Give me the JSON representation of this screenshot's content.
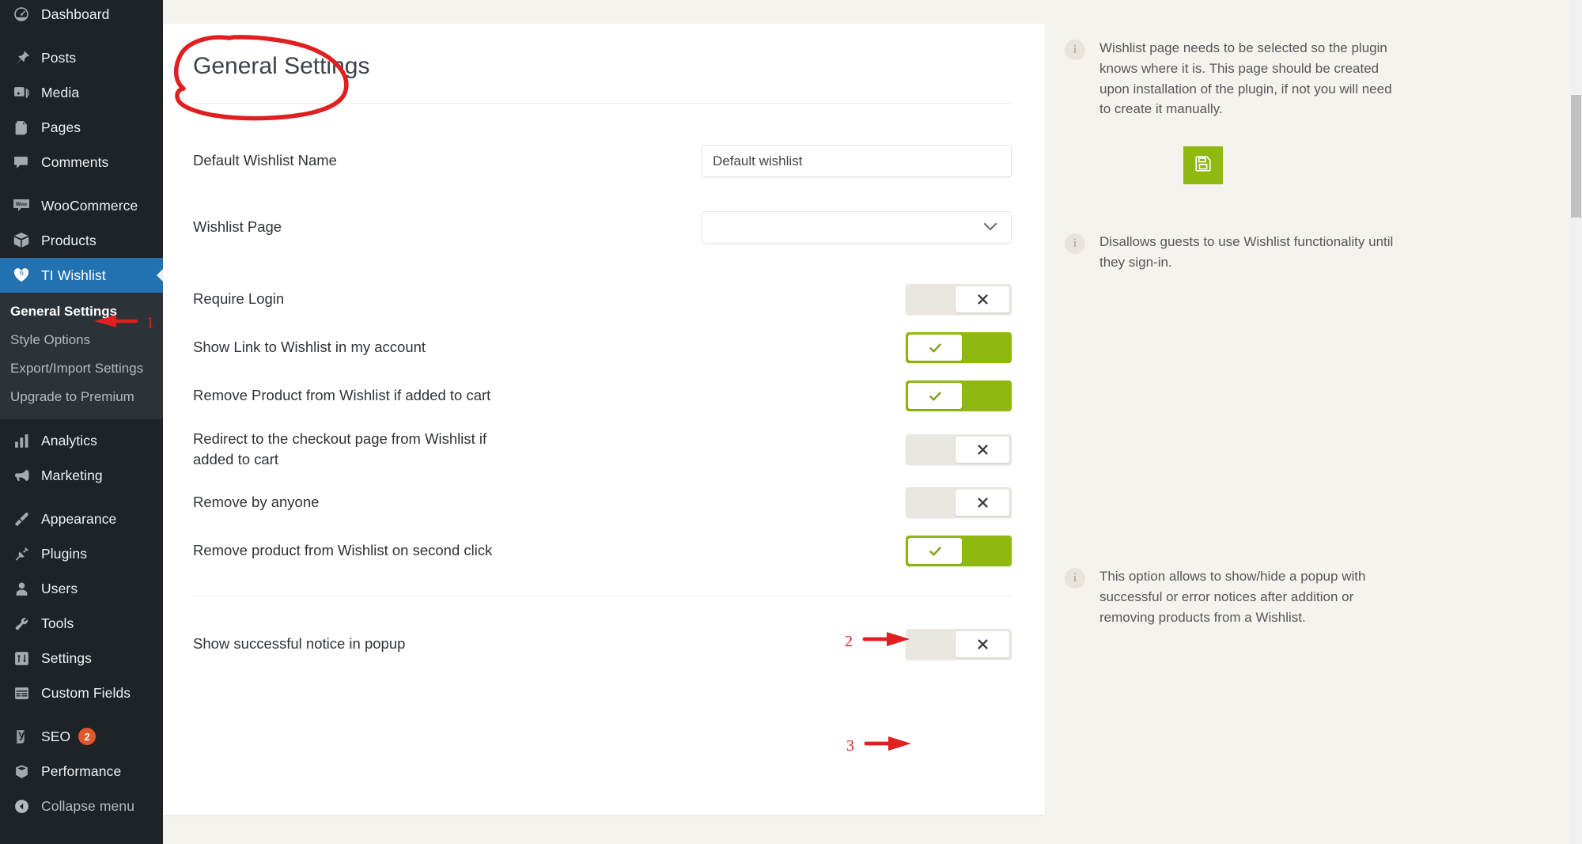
{
  "sidebar": {
    "items": [
      {
        "label": "Dashboard",
        "icon": "dashboard-icon"
      },
      {
        "label": "Posts",
        "icon": "pin-icon"
      },
      {
        "label": "Media",
        "icon": "media-icon"
      },
      {
        "label": "Pages",
        "icon": "pages-icon"
      },
      {
        "label": "Comments",
        "icon": "comment-icon"
      },
      {
        "label": "WooCommerce",
        "icon": "woo-icon"
      },
      {
        "label": "Products",
        "icon": "products-icon"
      },
      {
        "label": "TI Wishlist",
        "icon": "heart-icon"
      },
      {
        "label": "Analytics",
        "icon": "analytics-icon"
      },
      {
        "label": "Marketing",
        "icon": "megaphone-icon"
      },
      {
        "label": "Appearance",
        "icon": "brush-icon"
      },
      {
        "label": "Plugins",
        "icon": "plug-icon"
      },
      {
        "label": "Users",
        "icon": "user-icon"
      },
      {
        "label": "Tools",
        "icon": "wrench-icon"
      },
      {
        "label": "Settings",
        "icon": "sliders-icon"
      },
      {
        "label": "Custom Fields",
        "icon": "table-icon"
      },
      {
        "label": "SEO",
        "icon": "yoast-icon",
        "badge": "2"
      },
      {
        "label": "Performance",
        "icon": "performance-icon"
      },
      {
        "label": "Collapse menu",
        "icon": "collapse-icon"
      }
    ],
    "submenu": [
      {
        "label": "General Settings",
        "active": true
      },
      {
        "label": "Style Options",
        "active": false
      },
      {
        "label": "Export/Import Settings",
        "active": false
      },
      {
        "label": "Upgrade to Premium",
        "active": false
      }
    ]
  },
  "page": {
    "title": "General Settings"
  },
  "form": {
    "default_wishlist_name": {
      "label": "Default Wishlist Name",
      "value": "Default wishlist",
      "placeholder": ""
    },
    "wishlist_page": {
      "label": "Wishlist Page",
      "value": "",
      "chevron": "chevron-down-icon"
    },
    "toggles": [
      {
        "label": "Require Login",
        "state": "off",
        "glyph": "cross-icon"
      },
      {
        "label": "Show Link to Wishlist in my account",
        "state": "on",
        "glyph": "check-icon"
      },
      {
        "label": "Remove Product from Wishlist if added to cart",
        "state": "on",
        "glyph": "check-icon"
      },
      {
        "label": "Redirect to the checkout page from Wishlist if added to cart",
        "state": "off",
        "glyph": "cross-icon"
      },
      {
        "label": "Remove by anyone",
        "state": "off",
        "glyph": "cross-icon"
      },
      {
        "label": "Remove product from Wishlist on second click",
        "state": "on",
        "glyph": "check-icon"
      },
      {
        "label": "Show successful notice in popup",
        "state": "off",
        "glyph": "cross-icon"
      }
    ]
  },
  "info": [
    {
      "icon": "info-icon",
      "text": "Wishlist page needs to be selected so the plugin knows where it is. This page should be created upon installation of the plugin, if not you will need to create it manually."
    },
    {
      "icon": "info-icon",
      "text": "Disallows guests to use Wishlist functionality until they sign-in."
    },
    {
      "icon": "info-icon",
      "text": "This option allows to show/hide a popup with successful or error notices after addition or removing products from a Wishlist."
    }
  ],
  "save_button": {
    "icon": "save-icon",
    "title": "Save"
  },
  "annotations": {
    "ellipse_target": "General Settings",
    "markers": [
      {
        "number": "1",
        "target": "submenu-general-settings"
      },
      {
        "number": "2",
        "target": "toggle-remove-on-second-click"
      },
      {
        "number": "3",
        "target": "toggle-show-successful-notice"
      }
    ],
    "color": "#e02020"
  },
  "colors": {
    "sidebar_bg": "#1d2327",
    "sidebar_current": "#2271b1",
    "toggle_on": "#8fb911",
    "toggle_off": "#eae7e1",
    "page_bg": "#f6f3ee",
    "badge": "#e2562c"
  }
}
